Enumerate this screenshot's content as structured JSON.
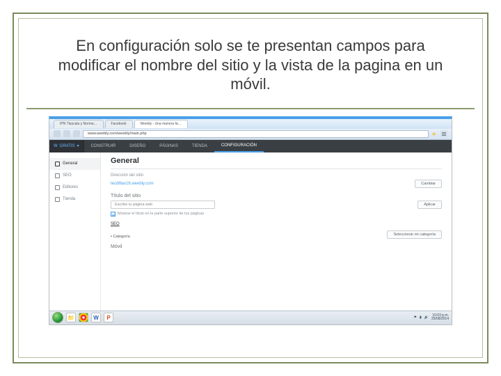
{
  "slide": {
    "heading": "En configuración solo se te presentan campos para modificar el nombre del sitio y la vista de la pagina en un móvil."
  },
  "browser": {
    "tabs": [
      {
        "label": "IPN Tlaxcala y Norma…"
      },
      {
        "label": "Facebook"
      },
      {
        "label": "Weebly - Una manera fá…"
      }
    ],
    "active_tab_index": 2,
    "address": "www.weebly.com/weebly/main.php"
  },
  "app": {
    "plan_label": "GRATIS",
    "nav": [
      {
        "label": "CONSTRUIR"
      },
      {
        "label": "DISEÑO"
      },
      {
        "label": "PÁGINAS"
      },
      {
        "label": "TIENDA"
      },
      {
        "label": "CONFIGURACIÓN"
      }
    ],
    "active_nav_index": 4
  },
  "sidebar": {
    "items": [
      {
        "label": "General"
      },
      {
        "label": "SEO"
      },
      {
        "label": "Editores"
      },
      {
        "label": "Tienda"
      }
    ],
    "active_index": 0
  },
  "content": {
    "page_title": "General",
    "address_label": "Dirección del sitio",
    "address_value": "tecdltlax16.weebly.com",
    "change_btn": "Cambiar",
    "site_title_label": "Título del sitio",
    "site_title_value": "Escribe tu página web",
    "apply_btn": "Aplicar",
    "checkbox_label": "Mostrar el título en la parte superior de tus páginas",
    "seo_label": "SEO",
    "category_label": "Categoría",
    "business_btn": "Seleccionar mi categoría",
    "mobile_label": "Móvil"
  },
  "taskbar": {
    "time": "10:03 p.m.",
    "date": "25/08/2014"
  }
}
